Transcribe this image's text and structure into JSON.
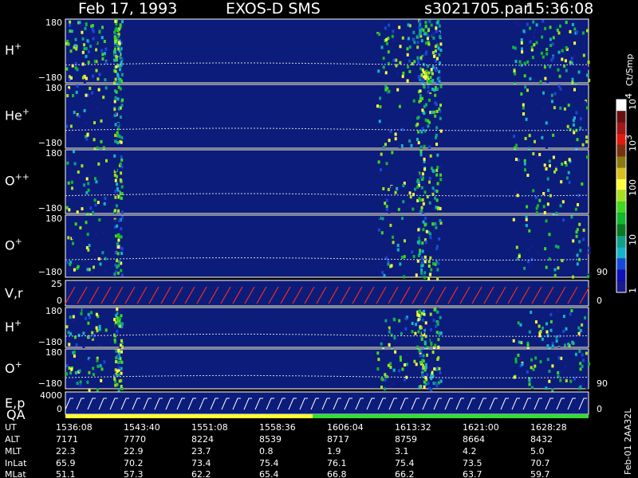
{
  "header": {
    "date": "Feb 17, 1993",
    "instrument": "EXOS-D SMS",
    "file": "s3021705.par",
    "time": "15:36:08"
  },
  "colors": {
    "background": "#000000",
    "panel_fill": "#0c1c7a",
    "trace": "#d8d8d8",
    "velocity_trace": "#ff2a1a",
    "qa_bar_yellow": "#ffff33",
    "qa_bar_green": "#33dd33"
  },
  "colorbar": {
    "unit": "Ct/Smp",
    "labels": [
      {
        "base": "10",
        "exp": "4"
      },
      {
        "base": "10",
        "exp": "3"
      },
      {
        "base": "100",
        "exp": ""
      },
      {
        "base": "10",
        "exp": ""
      },
      {
        "base": "1",
        "exp": ""
      }
    ],
    "colors": [
      "#1a1a8c",
      "#1010b8",
      "#1848d8",
      "#14b4c8",
      "#10a088",
      "#0a7a20",
      "#12b830",
      "#40d820",
      "#a8e020",
      "#ffff40",
      "#d8c020",
      "#8a7a10",
      "#7a3010",
      "#e01a10",
      "#a01818",
      "#681010",
      "#ffffff"
    ]
  },
  "chart_data": {
    "type": "heatmap",
    "panels": [
      {
        "ion": "H",
        "charge": "+",
        "ymax": "180",
        "ymin": "−180"
      },
      {
        "ion": "He",
        "charge": "+",
        "ymax": "180",
        "ymin": "−180"
      },
      {
        "ion": "O",
        "charge": "++",
        "ymax": "180",
        "ymin": "−180"
      },
      {
        "ion": "O",
        "charge": "+",
        "ymax": "180",
        "ymin": "−180",
        "right_label": "90"
      },
      {
        "ion": "V,r",
        "charge": "",
        "ymax": "25",
        "ymin": "0",
        "right_label": "0"
      },
      {
        "ion": "H",
        "charge": "+",
        "ymax": "180",
        "ymin": "−180"
      },
      {
        "ion": "O",
        "charge": "+",
        "ymax": "180",
        "ymin": "−180",
        "right_label": "90"
      },
      {
        "ion": "E,p",
        "ion2": "QA",
        "charge": "",
        "ymax": "4000",
        "ymin": "0",
        "right_label": "0"
      }
    ]
  },
  "footer": {
    "rows": [
      {
        "label": "UT",
        "values": [
          "1536:08",
          "1543:40",
          "1551:08",
          "1558:36",
          "1606:04",
          "1613:32",
          "1621:00",
          "1628:28"
        ]
      },
      {
        "label": "ALT",
        "values": [
          "7171",
          "7770",
          "8224",
          "8539",
          "8717",
          "8759",
          "8664",
          "8432"
        ]
      },
      {
        "label": "MLT",
        "values": [
          "22.3",
          "22.9",
          "23.7",
          "0.8",
          "1.9",
          "3.1",
          "4.2",
          "5.0"
        ]
      },
      {
        "label": "InLat",
        "values": [
          "65.9",
          "70.2",
          "73.4",
          "75.4",
          "76.1",
          "75.4",
          "73.5",
          "70.7"
        ]
      },
      {
        "label": "MLat",
        "values": [
          "51.1",
          "57.3",
          "62.2",
          "65.4",
          "66.8",
          "66.2",
          "63.7",
          "59.7"
        ]
      }
    ],
    "footnote": "Feb-01 2AA32L"
  }
}
